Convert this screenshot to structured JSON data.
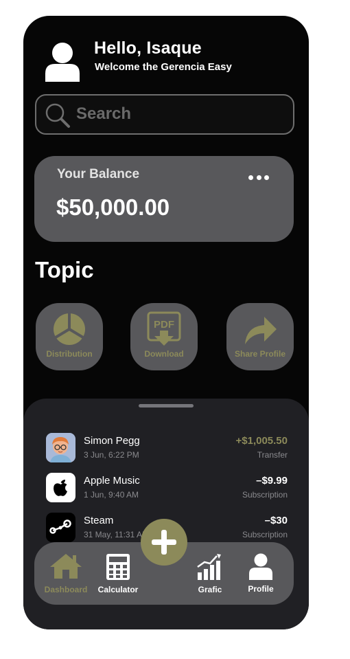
{
  "header": {
    "greeting": "Hello, Isaque",
    "welcome": "Welcome the Gerencia Easy",
    "avatar_icon": "user-icon"
  },
  "search": {
    "placeholder": "Search",
    "icon": "search-icon"
  },
  "balance": {
    "label": "Your Balance",
    "value": "$50,000.00",
    "menu_icon": "more-dots-icon"
  },
  "topics": {
    "title": "Topic",
    "items": [
      {
        "label": "Distribution",
        "icon": "distribution-icon"
      },
      {
        "label": "Download",
        "icon": "pdf-download-icon"
      },
      {
        "label": "Share Profile",
        "icon": "share-arrow-icon"
      }
    ]
  },
  "transactions": [
    {
      "name": "Simon Pegg",
      "date": "3 Jun, 6:22 PM",
      "amount": "+$1,005.50",
      "type": "Transfer",
      "icon": "person-avatar-icon"
    },
    {
      "name": "Apple Music",
      "date": "1 Jun, 9:40 AM",
      "amount": "–$9.99",
      "type": "Subscription",
      "icon": "apple-icon"
    },
    {
      "name": "Steam",
      "date": "31 May, 11:31 AM",
      "amount": "–$30",
      "type": "Subscription",
      "icon": "steam-icon"
    }
  ],
  "nav": {
    "items": [
      {
        "label": "Dashboard",
        "icon": "home-icon",
        "active": true
      },
      {
        "label": "Calculator",
        "icon": "calculator-icon",
        "active": false
      },
      {
        "label": "Grafic",
        "icon": "chart-icon",
        "active": false
      },
      {
        "label": "Profile",
        "icon": "profile-icon",
        "active": false
      }
    ],
    "fab_icon": "plus-icon"
  },
  "colors": {
    "background": "#060606",
    "card": "#58585b",
    "accent": "#8c8a5a",
    "sheet": "#202024"
  }
}
